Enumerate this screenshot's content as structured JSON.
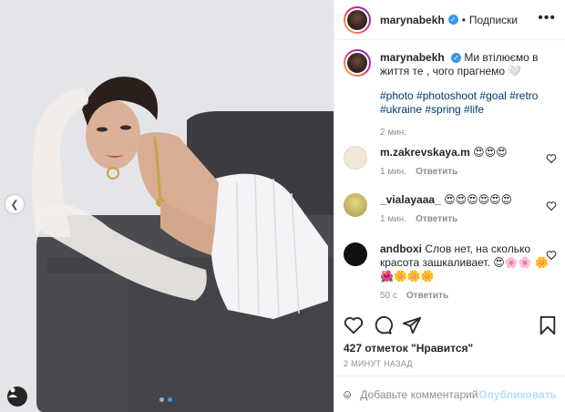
{
  "post": {
    "author": "marynabekh",
    "follow_label": "Подписки",
    "more_label": "•••",
    "caption_text": "Ми втілюємо в життя те , чого прагнемо 🤍",
    "hashtags": "#photo #photoshoot #goal #retro #ukraine #spring #life",
    "caption_time": "2 мин.",
    "likes": "427 отметок \"Нравится\"",
    "posted_ago": "2 МИНУТ НАЗАД",
    "comment_placeholder": "Добавьте комментарий...",
    "publish_label": "Опубликовать",
    "carousel": {
      "count": 2,
      "active_index": 1
    }
  },
  "comments": [
    {
      "user": "m.zakrevskaya.m",
      "text": "😍😍😍",
      "time": "1 мин.",
      "reply": "Ответить",
      "avatar_color": "#f1e7d6"
    },
    {
      "user": "_vialayaaa_",
      "text": "😍😍😍😍😍😍",
      "time": "1 мин.",
      "reply": "Ответить",
      "avatar_color": "#c8b86a"
    },
    {
      "user": "andboxi",
      "text": "Слов нет, на сколько красота зашкаливает. 😍🌸🌸 🌼🌺🌼🌼🌼",
      "time": "50 с",
      "reply": "Ответить",
      "avatar_color": "#111111"
    }
  ],
  "icons": [
    "more-icon",
    "verified-icon",
    "heart-icon",
    "comment-icon",
    "share-icon",
    "bookmark-icon",
    "emoji-icon",
    "tag-user-icon",
    "chevron-left-icon"
  ],
  "colors": {
    "accent_blue": "#3897f0",
    "hashtag": "#00376b",
    "muted": "#8e8e8e",
    "publish_disabled": "#b2dffc"
  }
}
